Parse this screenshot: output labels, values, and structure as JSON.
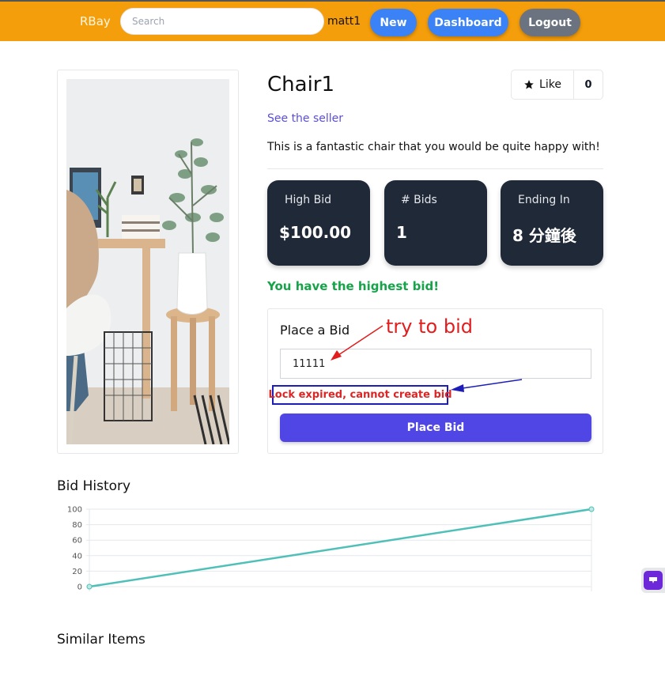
{
  "nav": {
    "brand": "RBay",
    "search_placeholder": "Search",
    "username": "matt1",
    "new_label": "New",
    "dashboard_label": "Dashboard",
    "logout_label": "Logout",
    "bar_color": "#f59e0b"
  },
  "item": {
    "title": "Chair1",
    "like_label": "Like",
    "like_count": "0",
    "seller_link": "See the seller",
    "description": "This is a fantastic chair that you would be quite happy with!"
  },
  "stats": [
    {
      "label": "High Bid",
      "value": "$100.00"
    },
    {
      "label": "# Bids",
      "value": "1"
    },
    {
      "label": "Ending In",
      "value": "8 分鐘後"
    }
  ],
  "highest_message": "You have the highest bid!",
  "bid_form": {
    "title": "Place a Bid",
    "input_value": "11111",
    "error": "Lock expired, cannot create bid",
    "button_label": "Place Bid"
  },
  "annotation": {
    "text": "try to bid",
    "red": "#e11d1d",
    "blue": "#1d1db8"
  },
  "bid_history": {
    "title": "Bid History"
  },
  "chart_data": {
    "type": "line",
    "title": "",
    "xlabel": "",
    "ylabel": "",
    "ylim": [
      0,
      100
    ],
    "yticks": [
      "100",
      "80",
      "60",
      "40",
      "20",
      "0"
    ],
    "series": [
      {
        "color": "#4fc0b8",
        "points": [
          {
            "x": 0,
            "y": 0
          },
          {
            "x": 1,
            "y": 100
          }
        ]
      }
    ]
  },
  "similar_items": {
    "title": "Similar Items"
  }
}
